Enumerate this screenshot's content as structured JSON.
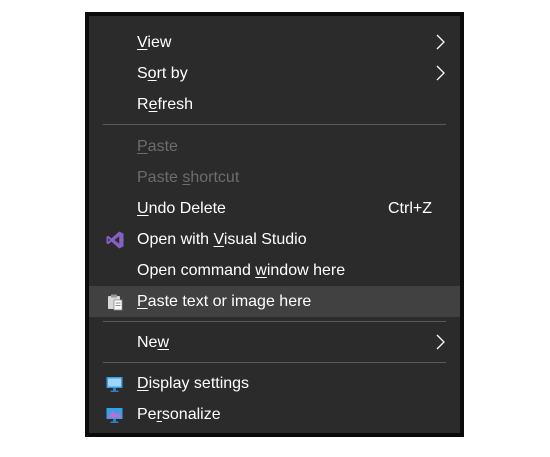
{
  "menu": {
    "view": {
      "pre": "",
      "acc": "V",
      "post": "iew"
    },
    "sort_by": {
      "pre": "S",
      "acc": "o",
      "post": "rt by"
    },
    "refresh": {
      "pre": "R",
      "acc": "e",
      "post": "fresh"
    },
    "paste": {
      "pre": "",
      "acc": "P",
      "post": "aste"
    },
    "paste_shortcut": {
      "pre": "Paste ",
      "acc": "s",
      "post": "hortcut"
    },
    "undo_delete": {
      "pre": "",
      "acc": "U",
      "post": "ndo Delete",
      "shortcut": "Ctrl+Z"
    },
    "open_vs": {
      "pre": "Open with ",
      "acc": "V",
      "post": "isual Studio"
    },
    "open_cmd": {
      "pre": "Open command ",
      "acc": "w",
      "post": "indow here"
    },
    "paste_text": {
      "pre": "",
      "acc": "P",
      "post": "aste text or image here"
    },
    "new": {
      "pre": "Ne",
      "acc": "w",
      "post": ""
    },
    "display_settings": {
      "pre": "",
      "acc": "D",
      "post": "isplay settings"
    },
    "personalize": {
      "pre": "Pe",
      "acc": "r",
      "post": "sonalize"
    }
  },
  "icons": {
    "submenu": "chevron-right-icon",
    "open_vs": "visual-studio-icon",
    "paste_text": "clipboard-paste-icon",
    "display_settings": "display-settings-icon",
    "personalize": "personalize-icon"
  },
  "colors": {
    "menu_bg": "#2b2b2b",
    "hover_bg": "#414141",
    "text": "#ffffff",
    "disabled_text": "#6d6d6d",
    "separator": "#5a5a5a",
    "visual_studio_purple": "#8661c5"
  }
}
